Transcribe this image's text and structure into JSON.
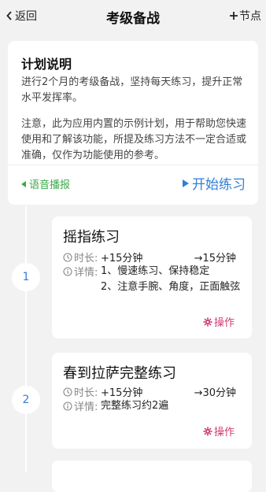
{
  "nav": {
    "back_label": "返回",
    "title": "考级备战",
    "add_label": "节点"
  },
  "plan": {
    "title": "计划说明",
    "description": "进行2个月的考级备战，坚持每天练习，提升正常水平发挥率。",
    "note": "注意，此为应用内置的示例计划，用于帮助您快速使用和了解该功能，所提及练习方法不一定合适或准确，仅作为功能使用的参考。",
    "voice_label": "语音播报",
    "start_label": "开始练习"
  },
  "steps": [
    {
      "index": "1",
      "title": "摇指练习",
      "duration_label": "时长:",
      "duration_increment": "+15分钟",
      "duration_total": "→15分钟",
      "detail_label": "详情:",
      "detail_line1": "1、慢速练习、保持稳定",
      "detail_line2": "2、注意手腕、角度，正面触弦",
      "action_label": "操作"
    },
    {
      "index": "2",
      "title": "春到拉萨完整练习",
      "duration_label": "时长:",
      "duration_increment": "+15分钟",
      "duration_total": "→30分钟",
      "detail_label": "详情:",
      "detail_line1": "完整练习约2遍",
      "action_label": "操作"
    }
  ],
  "colors": {
    "accent_blue": "#2f7fd9",
    "voice_green": "#3aaa47",
    "action_pink": "#d13a72",
    "background": "#f2f2f2"
  },
  "icons": {
    "back": "chevron-left-icon",
    "add": "plus-icon",
    "voice": "play-left-icon",
    "start": "play-icon",
    "duration": "clock-icon",
    "detail": "info-icon",
    "action": "gear-icon"
  }
}
